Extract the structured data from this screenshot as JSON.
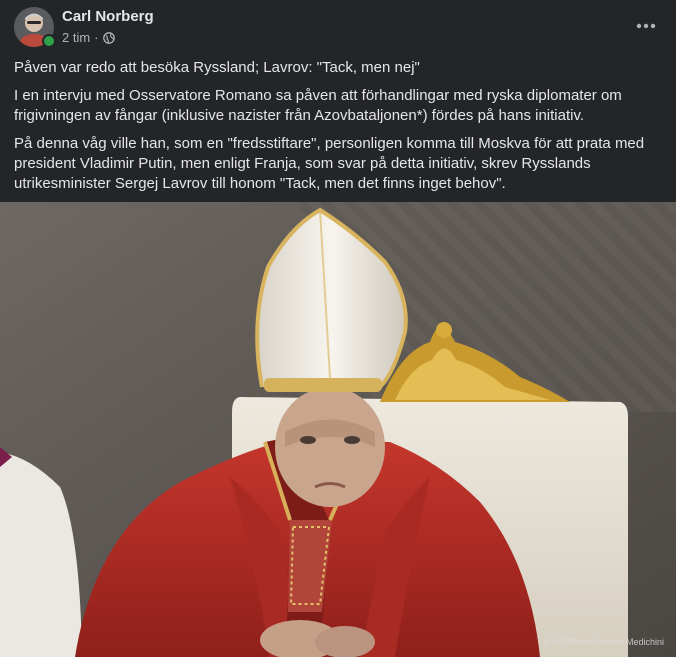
{
  "post": {
    "author": "Carl Norberg",
    "time": "2 tim",
    "separator": "·",
    "privacy_icon": "globe-icon",
    "more_icon": "more-horizontal-icon",
    "paragraphs": [
      "Påven var redo att besöka Ryssland; Lavrov: \"Tack, men nej\"",
      "I en intervju med Osservatore Romano sa påven att förhandlingar med ryska diplomater om frigivningen av fångar (inklusive nazister från Azovbataljonen*) fördes på hans initiativ.",
      " På denna våg ville han, som en \"fredsstiftare\", personligen komma till Moskva för att prata med president Vladimir Putin, men enligt Franja, som svar på detta initiativ, skrev Rysslands utrikesminister Sergej Lavrov till honom \"Tack, men det finns inget behov\"."
    ],
    "photo_credit": "© AP Photo/Andrew Medichini"
  },
  "colors": {
    "card_bg": "#242526",
    "text_primary": "#e4e6eb",
    "text_secondary": "#b0b3b8",
    "online": "#31a24c"
  }
}
